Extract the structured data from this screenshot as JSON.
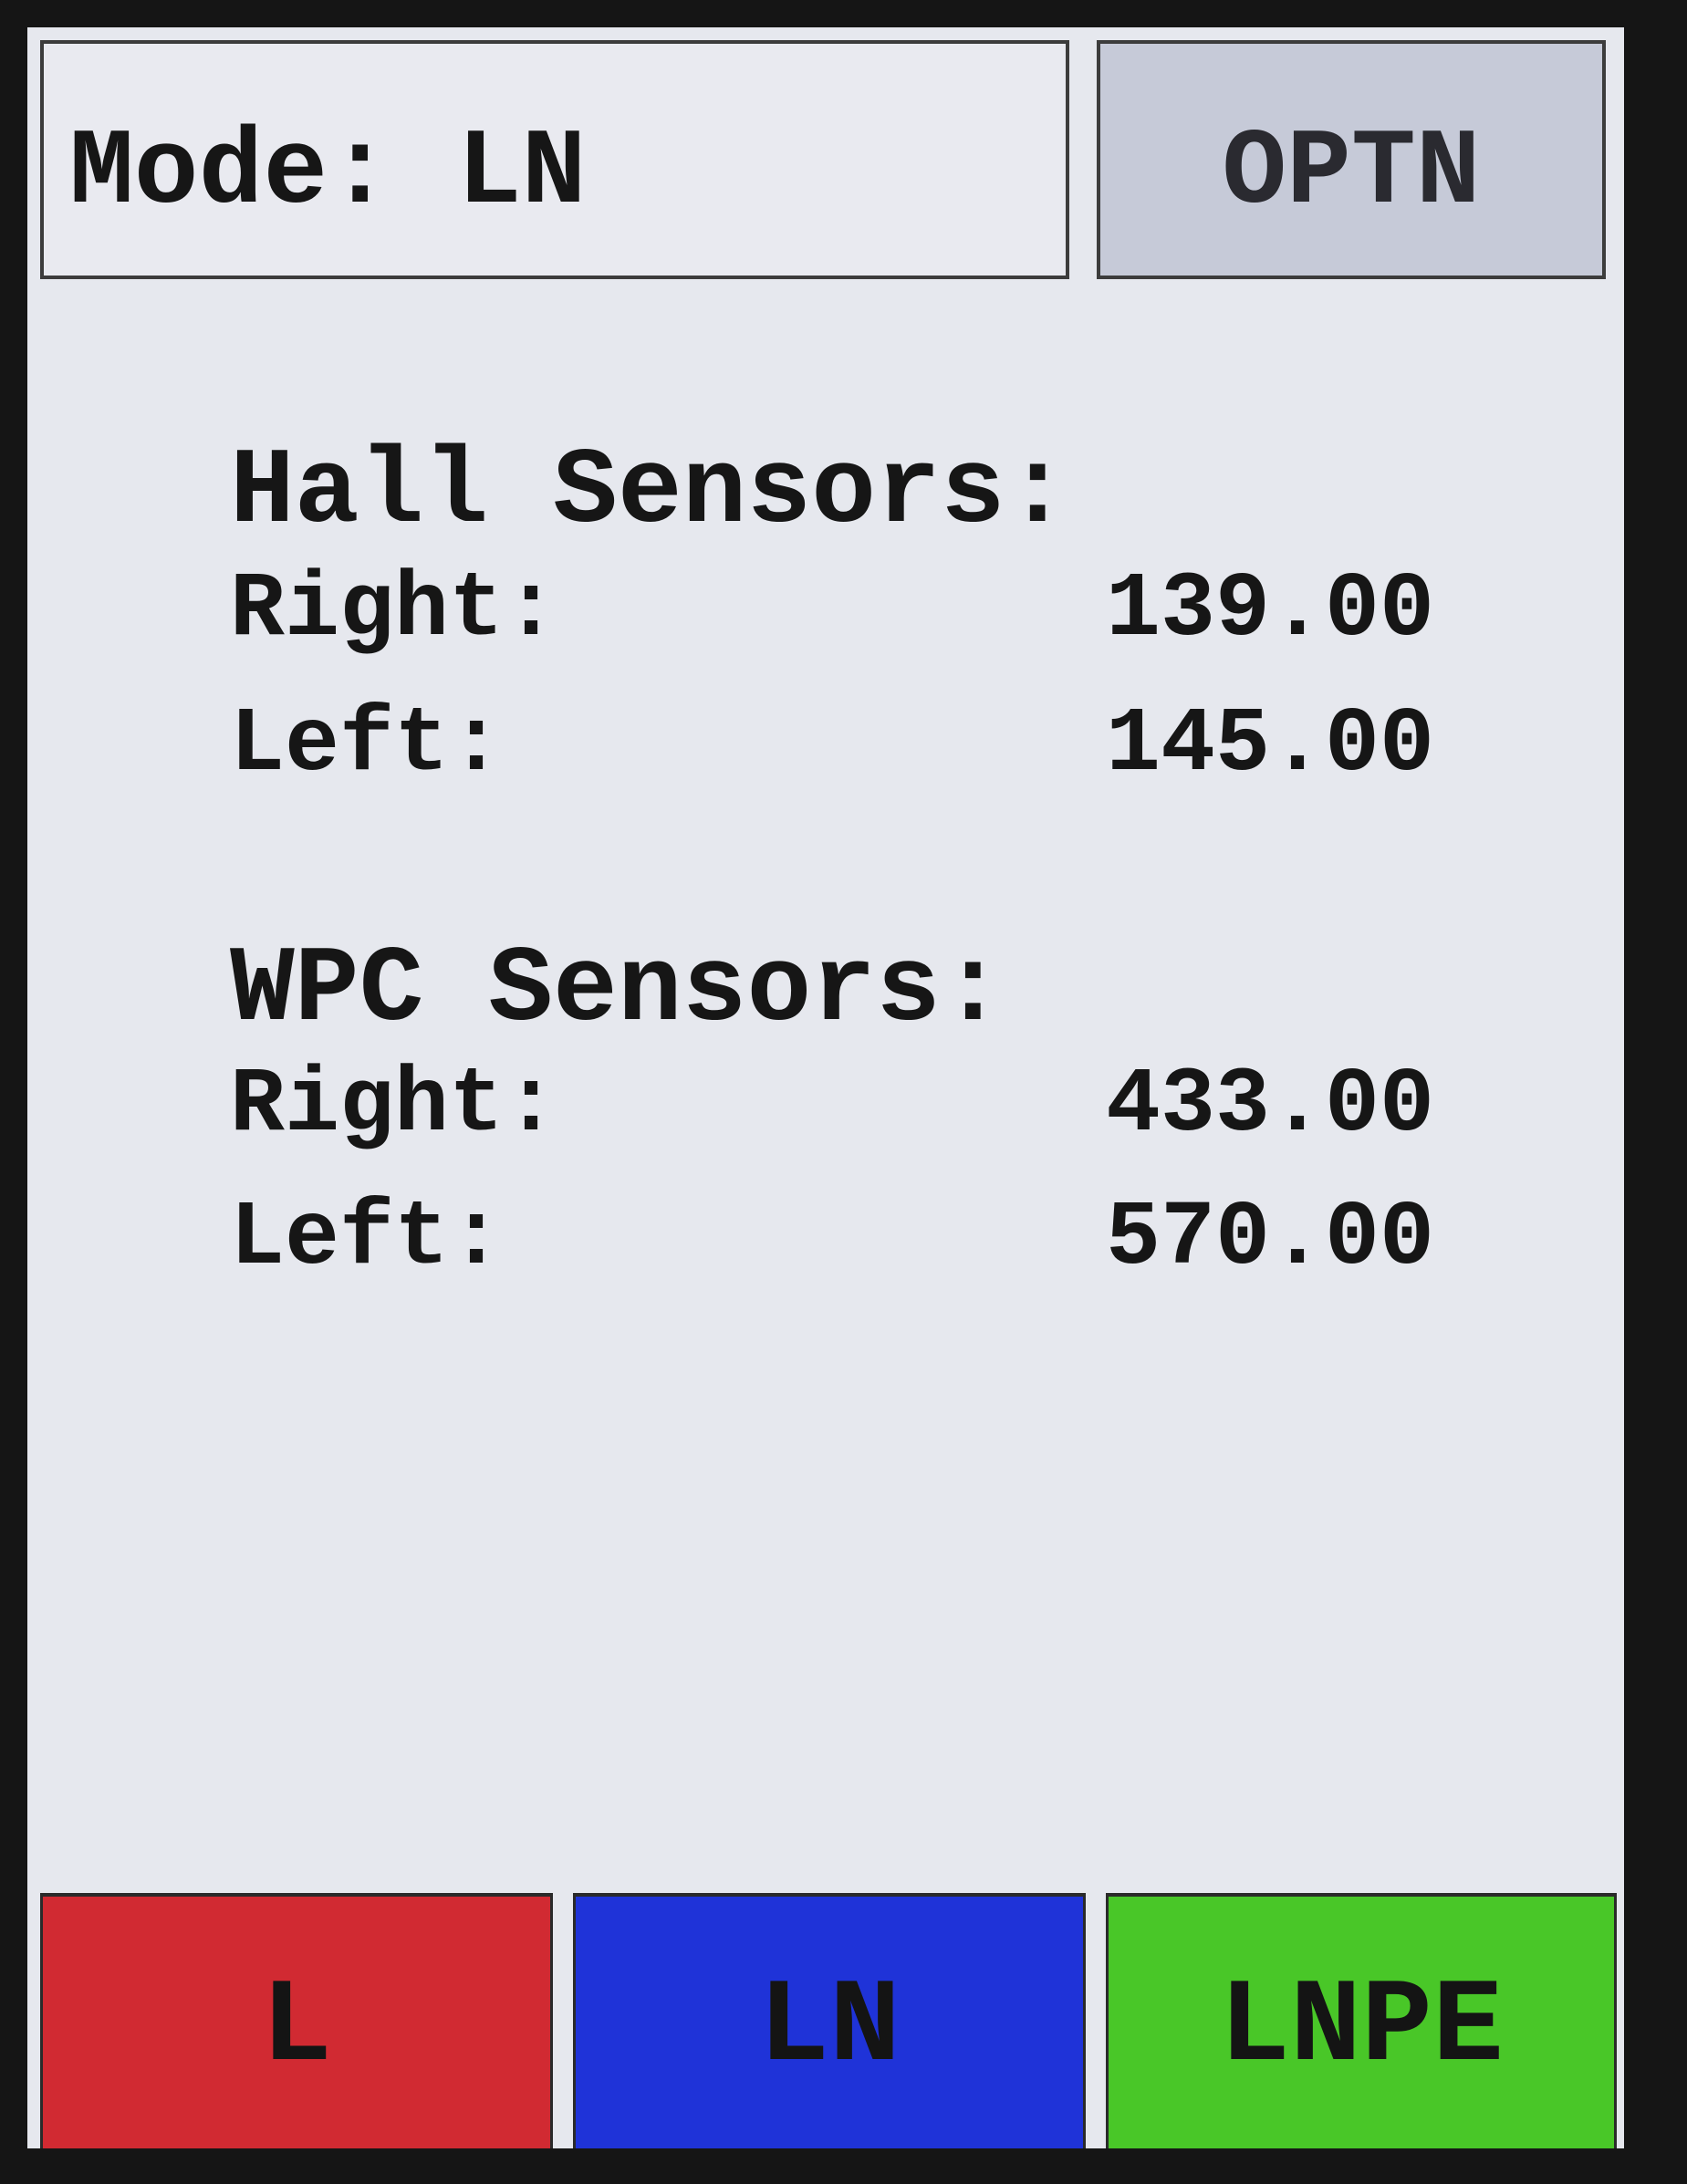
{
  "header": {
    "mode_label": "Mode: LN",
    "options_label": "OPTN"
  },
  "hall_sensors": {
    "heading": "Hall Sensors:",
    "rows": [
      {
        "label": "Right:",
        "value": "139.00"
      },
      {
        "label": "Left:",
        "value": "145.00"
      }
    ]
  },
  "wpc_sensors": {
    "heading": "WPC Sensors:",
    "rows": [
      {
        "label": "Right:",
        "value": "433.00"
      },
      {
        "label": "Left:",
        "value": "570.00"
      }
    ]
  },
  "mode_buttons": [
    {
      "label": "L",
      "color": "#d12a32"
    },
    {
      "label": "LN",
      "color": "#1f33d8"
    },
    {
      "label": "LNPE",
      "color": "#49c728"
    }
  ],
  "colors": {
    "screen_background": "#e6e8ee",
    "options_background": "#c6cad8"
  }
}
